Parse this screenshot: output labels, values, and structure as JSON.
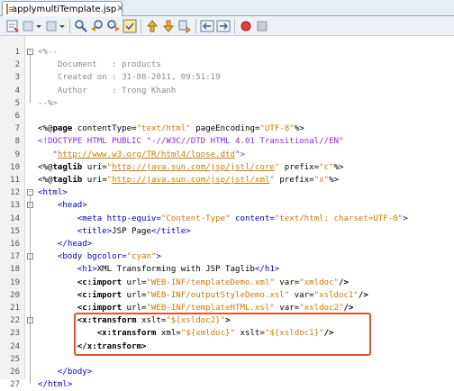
{
  "tab": {
    "title": "applymultiTemplate.jsp",
    "close": "×"
  },
  "toolbar": {
    "buttons": [
      "last-edit-icon",
      "back-icon",
      "forward-icon",
      "find-icon",
      "find-previous-icon",
      "find-next-icon",
      "toggle-highlight-icon",
      "previous-bookmark-icon",
      "next-bookmark-icon",
      "toggle-bookmark-icon",
      "shift-left-icon",
      "shift-right-icon",
      "start-macro-icon",
      "stop-macro-icon"
    ]
  },
  "lines": [
    {
      "n": "1",
      "fold": "-",
      "segs": [
        {
          "c": "c-com",
          "t": "<%--"
        }
      ]
    },
    {
      "n": "2",
      "segs": [
        {
          "c": "c-com",
          "t": "    Document   : products"
        }
      ]
    },
    {
      "n": "3",
      "segs": [
        {
          "c": "c-com",
          "t": "    Created on : 31-08-2011, 09:51:19"
        }
      ]
    },
    {
      "n": "4",
      "segs": [
        {
          "c": "c-com",
          "t": "    Author     : Trong Khanh"
        }
      ]
    },
    {
      "n": "5",
      "segs": [
        {
          "c": "c-com",
          "t": "--%>"
        }
      ]
    },
    {
      "n": "6",
      "segs": []
    },
    {
      "n": "7",
      "segs": [
        {
          "c": "c-dir",
          "t": "<%@"
        },
        {
          "c": "c-kw",
          "t": "page"
        },
        {
          "c": "c-attr",
          "t": " contentType="
        },
        {
          "c": "c-val",
          "t": "\"text/html\""
        },
        {
          "c": "c-attr",
          "t": " pageEncoding="
        },
        {
          "c": "c-val",
          "t": "\"UTF-8\""
        },
        {
          "c": "c-dir",
          "t": "%>"
        }
      ]
    },
    {
      "n": "8",
      "segs": [
        {
          "c": "c-doctype",
          "t": "<!DOCTYPE HTML PUBLIC \"-//W3C//DTD HTML 4.01 Transitional//EN\""
        }
      ]
    },
    {
      "n": "9",
      "segs": [
        {
          "c": "c-doctype",
          "t": "   \""
        },
        {
          "c": "c-link",
          "t": "http://www.w3.org/TR/html4/loose.dtd"
        },
        {
          "c": "c-doctype",
          "t": "\">"
        }
      ]
    },
    {
      "n": "10",
      "segs": [
        {
          "c": "c-dir",
          "t": "<%@"
        },
        {
          "c": "c-kw",
          "t": "taglib"
        },
        {
          "c": "c-attr",
          "t": " uri="
        },
        {
          "c": "c-val",
          "t": "\""
        },
        {
          "c": "c-link",
          "t": "http://java.sun.com/jsp/jstl/core"
        },
        {
          "c": "c-val",
          "t": "\""
        },
        {
          "c": "c-attr",
          "t": " prefix="
        },
        {
          "c": "c-val",
          "t": "\"c\""
        },
        {
          "c": "c-dir",
          "t": "%>"
        }
      ]
    },
    {
      "n": "11",
      "segs": [
        {
          "c": "c-dir",
          "t": "<%@"
        },
        {
          "c": "c-kw",
          "t": "taglib"
        },
        {
          "c": "c-attr",
          "t": " uri="
        },
        {
          "c": "c-val",
          "t": "\""
        },
        {
          "c": "c-link",
          "t": "http://java.sun.com/jsp/jstl/xml"
        },
        {
          "c": "c-val",
          "t": "\""
        },
        {
          "c": "c-attr",
          "t": " prefix="
        },
        {
          "c": "c-val",
          "t": "\"x\""
        },
        {
          "c": "c-dir",
          "t": "%>"
        }
      ]
    },
    {
      "n": "12",
      "fold": "-",
      "segs": [
        {
          "c": "c-tag",
          "t": "<html>"
        }
      ]
    },
    {
      "n": "13",
      "fold": "-",
      "segs": [
        {
          "c": "c-tag",
          "t": "    <head>"
        }
      ]
    },
    {
      "n": "14",
      "segs": [
        {
          "c": "c-tag",
          "t": "        <meta"
        },
        {
          "c": "c-tag",
          "t": " http-equiv="
        },
        {
          "c": "c-val",
          "t": "\"Content-Type\""
        },
        {
          "c": "c-tag",
          "t": " content="
        },
        {
          "c": "c-val",
          "t": "\"text/html; charset=UTF-8\""
        },
        {
          "c": "c-tag",
          "t": ">"
        }
      ]
    },
    {
      "n": "15",
      "segs": [
        {
          "c": "c-tag",
          "t": "        <title>"
        },
        {
          "c": "c-txt",
          "t": "JSP Page"
        },
        {
          "c": "c-tag",
          "t": "</title>"
        }
      ]
    },
    {
      "n": "16",
      "segs": [
        {
          "c": "c-tag",
          "t": "    </head>"
        }
      ]
    },
    {
      "n": "17",
      "fold": "-",
      "segs": [
        {
          "c": "c-tag",
          "t": "    <body"
        },
        {
          "c": "c-tag",
          "t": " bgcolor="
        },
        {
          "c": "c-val",
          "t": "\"cyan\""
        },
        {
          "c": "c-tag",
          "t": ">"
        }
      ]
    },
    {
      "n": "18",
      "segs": [
        {
          "c": "c-tag",
          "t": "        <h1>"
        },
        {
          "c": "c-txt",
          "t": "XML Transforming with JSP Taglib"
        },
        {
          "c": "c-tag",
          "t": "</h1>"
        }
      ]
    },
    {
      "n": "19",
      "segs": [
        {
          "c": "c-tagb",
          "t": "        <c:import"
        },
        {
          "c": "c-attr",
          "t": " url="
        },
        {
          "c": "c-val",
          "t": "\"WEB-INF/templateDemo.xml\""
        },
        {
          "c": "c-attr",
          "t": " var="
        },
        {
          "c": "c-val",
          "t": "\"xmldoc\""
        },
        {
          "c": "c-tagb",
          "t": "/>"
        }
      ]
    },
    {
      "n": "20",
      "segs": [
        {
          "c": "c-tagb",
          "t": "        <c:import"
        },
        {
          "c": "c-attr",
          "t": " url="
        },
        {
          "c": "c-val",
          "t": "\"WEB-INF/outputStyleDemo.xsl\""
        },
        {
          "c": "c-attr",
          "t": " var="
        },
        {
          "c": "c-val",
          "t": "\"xsldoc1\""
        },
        {
          "c": "c-tagb",
          "t": "/>"
        }
      ]
    },
    {
      "n": "21",
      "segs": [
        {
          "c": "c-tagb",
          "t": "        <c:import"
        },
        {
          "c": "c-attr",
          "t": " url="
        },
        {
          "c": "c-val",
          "t": "\"WEB-INF/templateHTML.xsl\""
        },
        {
          "c": "c-attr",
          "t": " var="
        },
        {
          "c": "c-val",
          "t": "\"xsldoc2\""
        },
        {
          "c": "c-tagb",
          "t": "/>"
        }
      ]
    },
    {
      "n": "22",
      "fold": "-",
      "segs": [
        {
          "c": "c-tagb",
          "t": "        <x:transform"
        },
        {
          "c": "c-attr",
          "t": " xslt="
        },
        {
          "c": "c-val",
          "t": "\"${xsldoc2}\""
        },
        {
          "c": "c-tagb",
          "t": ">"
        }
      ]
    },
    {
      "n": "23",
      "segs": [
        {
          "c": "c-tagb",
          "t": "            <x:transform"
        },
        {
          "c": "c-attr",
          "t": " xml="
        },
        {
          "c": "c-val",
          "t": "\"${xmldoc}\""
        },
        {
          "c": "c-attr",
          "t": " xslt="
        },
        {
          "c": "c-val",
          "t": "\"${xsldoc1}\""
        },
        {
          "c": "c-tagb",
          "t": "/>"
        }
      ]
    },
    {
      "n": "24",
      "segs": [
        {
          "c": "c-tagb",
          "t": "        </x:transform>"
        }
      ]
    },
    {
      "n": "25",
      "segs": []
    },
    {
      "n": "26",
      "segs": [
        {
          "c": "c-tag",
          "t": "    </body>"
        }
      ]
    },
    {
      "n": "27",
      "segs": [
        {
          "c": "c-tag",
          "t": "</html>"
        }
      ]
    }
  ]
}
